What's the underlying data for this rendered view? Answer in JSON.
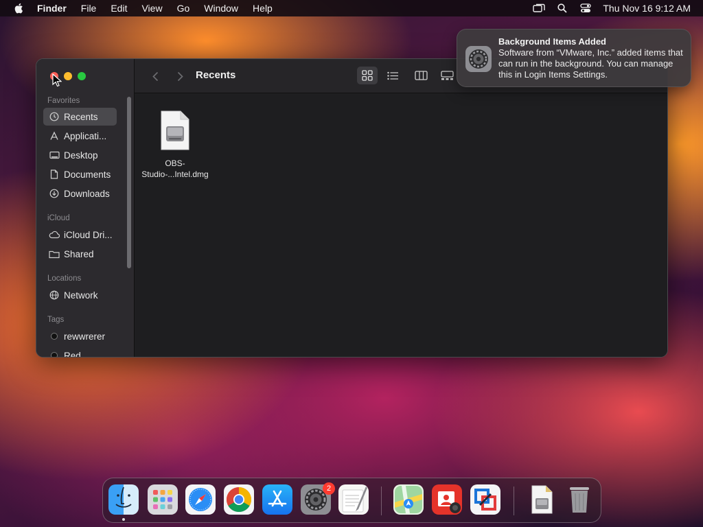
{
  "menubar": {
    "app_name": "Finder",
    "menus": [
      "File",
      "Edit",
      "View",
      "Go",
      "Window",
      "Help"
    ],
    "clock": "Thu Nov 16  9:12 AM"
  },
  "finder": {
    "title": "Recents",
    "sidebar": {
      "favorites_header": "Favorites",
      "favorites": [
        {
          "label": "Recents",
          "icon": "clock-icon"
        },
        {
          "label": "Applicati...",
          "icon": "applications-icon"
        },
        {
          "label": "Desktop",
          "icon": "desktop-icon"
        },
        {
          "label": "Documents",
          "icon": "document-icon"
        },
        {
          "label": "Downloads",
          "icon": "download-icon"
        }
      ],
      "icloud_header": "iCloud",
      "icloud": [
        {
          "label": "iCloud Dri...",
          "icon": "cloud-icon"
        },
        {
          "label": "Shared",
          "icon": "shared-folder-icon"
        }
      ],
      "locations_header": "Locations",
      "locations": [
        {
          "label": "Network",
          "icon": "globe-icon"
        }
      ],
      "tags_header": "Tags",
      "tags": [
        {
          "label": "rewwrerer"
        },
        {
          "label": "Red"
        }
      ]
    },
    "files": [
      {
        "name_line1": "OBS-",
        "name_line2": "Studio-...Intel.dmg",
        "icon": "disk-image-icon"
      }
    ]
  },
  "notification": {
    "title": "Background Items Added",
    "body": "Software from “VMware, Inc.” added items that can run in the background. You can manage this in Login Items Settings."
  },
  "dock": {
    "apps": [
      "finder",
      "launchpad",
      "safari",
      "chrome",
      "app-store",
      "system-settings",
      "textedit",
      "maps",
      "photo-booth",
      "vmware-fusion",
      "disk-image",
      "trash"
    ],
    "settings_badge": "2"
  }
}
